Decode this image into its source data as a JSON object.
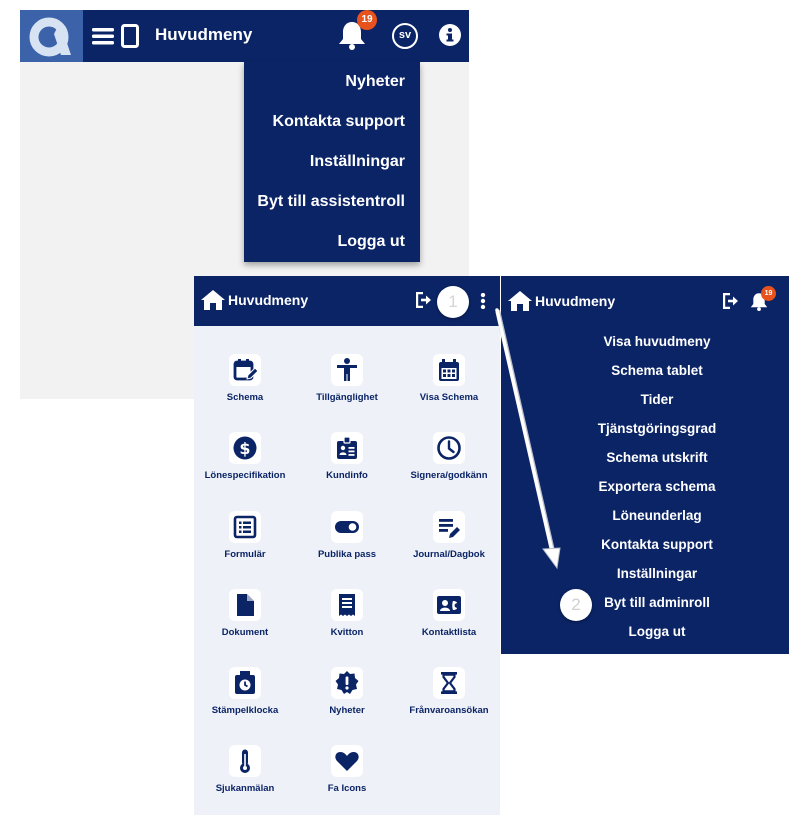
{
  "desktop": {
    "header": {
      "title": "Huvudmeny",
      "notification_count": "19",
      "avatar_initials": "sv"
    },
    "menu": [
      {
        "label": "Nyheter"
      },
      {
        "label": "Kontakta support"
      },
      {
        "label": "Inställningar"
      },
      {
        "label": "Byt till assistentroll"
      },
      {
        "label": "Logga ut"
      }
    ]
  },
  "mobile": {
    "header": {
      "title": "Huvudmeny",
      "step_number": "1"
    },
    "tiles": [
      {
        "label": "Schema",
        "icon": "calendar-edit-icon"
      },
      {
        "label": "Tillgänglighet",
        "icon": "accessibility-person-icon"
      },
      {
        "label": "Visa Schema",
        "icon": "calendar-grid-icon"
      },
      {
        "label": "Lönespecifikation",
        "icon": "dollar-circle-icon"
      },
      {
        "label": "Kundinfo",
        "icon": "id-badge-icon"
      },
      {
        "label": "Signera/godkänn",
        "icon": "clock-icon"
      },
      {
        "label": "Formulär",
        "icon": "list-form-icon"
      },
      {
        "label": "Publika pass",
        "icon": "toggle-icon"
      },
      {
        "label": "Journal/Dagbok",
        "icon": "journal-edit-icon"
      },
      {
        "label": "Dokument",
        "icon": "document-icon"
      },
      {
        "label": "Kvitton",
        "icon": "receipt-icon"
      },
      {
        "label": "Kontaktlista",
        "icon": "contact-card-icon"
      },
      {
        "label": "Stämpelklocka",
        "icon": "punch-clock-icon"
      },
      {
        "label": "Nyheter",
        "icon": "news-badge-icon"
      },
      {
        "label": "Frånvaroansökan",
        "icon": "hourglass-icon"
      },
      {
        "label": "Sjukanmälan",
        "icon": "thermometer-icon"
      },
      {
        "label": "Fa Icons",
        "icon": "heart-icon"
      }
    ]
  },
  "right_panel": {
    "header": {
      "title": "Huvudmeny",
      "notification_count": "19"
    },
    "menu": [
      {
        "label": "Visa huvudmeny"
      },
      {
        "label": "Schema tablet"
      },
      {
        "label": "Tider"
      },
      {
        "label": "Tjänstgöringsgrad"
      },
      {
        "label": "Schema utskrift"
      },
      {
        "label": "Exportera schema"
      },
      {
        "label": "Löneunderlag"
      },
      {
        "label": "Kontakta support"
      },
      {
        "label": "Inställningar"
      },
      {
        "label": "Byt till adminroll"
      },
      {
        "label": "Logga ut"
      }
    ],
    "step_number": "2"
  },
  "colors": {
    "navy": "#0b2466",
    "logo_blue": "#3c63aa",
    "badge_orange": "#e8521d",
    "tile_background": "#eef1f7"
  }
}
